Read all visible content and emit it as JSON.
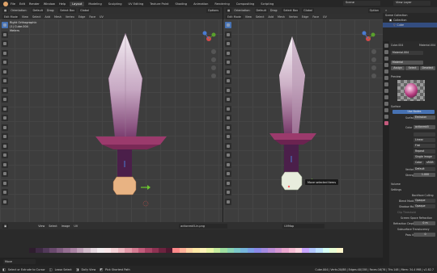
{
  "menubar": {
    "menus": [
      "File",
      "Edit",
      "Render",
      "Window",
      "Help"
    ],
    "workspaces": [
      "Layout",
      "Modeling",
      "Sculpting",
      "UV Editing",
      "Texture Paint",
      "Shading",
      "Animation",
      "Rendering",
      "Compositing",
      "Scripting"
    ],
    "active_workspace": "Layout",
    "scene": "Scene",
    "view_layer": "View Layer"
  },
  "left_viewport": {
    "mode": "Edit Mode",
    "menus": [
      "View",
      "Select",
      "Add",
      "Mesh",
      "Vertex",
      "Edge",
      "Face",
      "UV"
    ],
    "orientation_label": "Orientation:",
    "orientation_value": "Default",
    "drag_label": "Drag:",
    "drag_value": "Select Box",
    "transform_value": "Global",
    "options": "Options",
    "info_line1": "Right Orthographic",
    "info_line2": "(1) Cube.004",
    "info_line3": "Meters"
  },
  "right_viewport": {
    "mode": "Edit Mode",
    "menus": [
      "View",
      "Select",
      "Add",
      "Mesh",
      "Vertex",
      "Edge",
      "Face",
      "UV"
    ],
    "orientation_label": "Orientation:",
    "orientation_value": "Default",
    "drag_label": "Drag:",
    "drag_value": "Select Box",
    "transform_value": "Global",
    "options": "Option",
    "tooltip": "Move selected items"
  },
  "uv_editor": {
    "menus": [
      "View",
      "Select",
      "Image",
      "UV"
    ],
    "image_name": "actionmk5-in.png",
    "uvmap": "UVMap"
  },
  "outliner": {
    "title": "Scene Collection",
    "items": [
      "Collection",
      "Cube"
    ]
  },
  "properties": {
    "object_name": "Cube.004",
    "material_tab": "Material",
    "material_slot": "Material.004",
    "material_name": "Material",
    "assign": "Assign",
    "select": "Select",
    "deselect": "Deselect",
    "preview_label": "Preview",
    "surface_label": "Surface",
    "use_nodes": "Use Nodes",
    "surface_key": "Surface",
    "surface_value": "Emission",
    "color_key": "Color",
    "color_value": "actionmk5",
    "linear": "Linear",
    "flat": "Flat",
    "repeat": "Repeat",
    "single_image": "Single Image",
    "color_space": "Color",
    "alpha": "sRGB",
    "vector_key": "Vector",
    "vector_value": "Default",
    "strength_key": "Strength",
    "strength_value": "1.000",
    "volume_label": "Volume",
    "settings_label": "Settings",
    "backface_culling": "Backface Culling",
    "blend_mode_key": "Blend Mode",
    "blend_mode_value": "Opaque",
    "shadow_mode_key": "Shadow Mode",
    "shadow_mode_value": "Opaque",
    "clip_threshold": "Clip Threshold",
    "ssr": "Screen Space Refraction",
    "refraction_depth_key": "Refraction Depth",
    "refraction_depth_value": "0 m",
    "subsurface": "Subsurface Translucency",
    "pass_index_key": "Pass Index",
    "pass_index_value": "0"
  },
  "status_bar": {
    "hint_move": "Move",
    "left": "Select or Extrude to Cursor",
    "lasso": "Lasso Select",
    "dolly": "Dolly View",
    "pick": "Pick Shortest Path",
    "stats": "Cube.004 | Verts:20/88 | Edges:40/158 | Faces:16/76 | Tris:148 | Mem: 34.4 MiB | v2.82.7"
  },
  "colors": {
    "accent": "#4772b3",
    "blade_light": "#ede4ec",
    "blade_dark": "#8a4a7d",
    "guard": "#9b3a6c",
    "handle": "#4b1f4a",
    "pommel": "#e8b383"
  },
  "palette_colors": [
    "#2e1d2e",
    "#3f2a45",
    "#523a5a",
    "#6a4a6e",
    "#7f5c80",
    "#956f92",
    "#aa84a4",
    "#bfa0b8",
    "#d2bccb",
    "#e6d8e0",
    "#f3ecef",
    "#f9e7ea",
    "#f5d2d7",
    "#eeb9c2",
    "#e29aa9",
    "#d47c92",
    "#c25c7b",
    "#a84465",
    "#8e3252",
    "#6e233f",
    "#4f1830",
    "#ff8a8a",
    "#ffb199",
    "#ffd3a3",
    "#ffe8a6",
    "#fff3b8",
    "#eaf5a6",
    "#c6ec9f",
    "#9fdea0",
    "#8ad4b3",
    "#7cc8c9",
    "#76b6dc",
    "#7b9ee6",
    "#8b8ae8",
    "#a38be0",
    "#bd8ed8",
    "#d597d1",
    "#eaa7cf",
    "#f6bdd6",
    "#fcd4e0",
    "#c9a6ff",
    "#b3c8ff",
    "#bfe3ff",
    "#d6fff5",
    "#e8ffd6",
    "#fff7cc"
  ]
}
